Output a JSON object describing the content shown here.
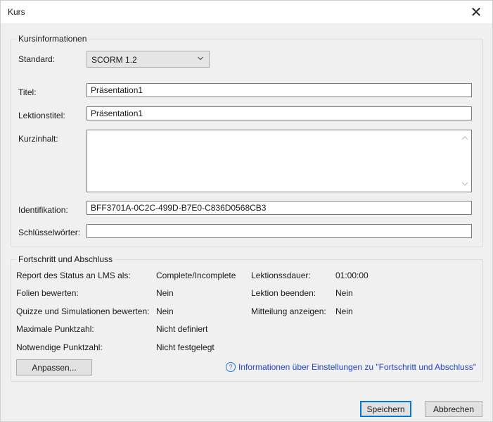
{
  "window": {
    "title": "Kurs",
    "close_glyph": "✕"
  },
  "course_info": {
    "legend": "Kursinformationen",
    "standard_label": "Standard:",
    "standard_value": "SCORM 1.2",
    "title_label": "Titel:",
    "title_value": "Präsentation1",
    "lesson_title_label": "Lektionstitel:",
    "lesson_title_value": "Präsentation1",
    "summary_label": "Kurzinhalt:",
    "summary_value": "",
    "id_label": "Identifikation:",
    "id_value": "BFF3701A-0C2C-499D-B7E0-C836D0568CB3",
    "keywords_label": "Schlüsselwörter:",
    "keywords_value": ""
  },
  "progress": {
    "legend": "Fortschritt und Abschluss",
    "rows_left": [
      {
        "label": "Report des Status an LMS als:",
        "value": "Complete/Incomplete"
      },
      {
        "label": "Folien bewerten:",
        "value": "Nein"
      },
      {
        "label": "Quizze und Simulationen bewerten:",
        "value": "Nein"
      },
      {
        "label": "Maximale Punktzahl:",
        "value": "Nicht definiert"
      },
      {
        "label": "Notwendige Punktzahl:",
        "value": "Nicht festgelegt"
      }
    ],
    "rows_right": [
      {
        "label": "Lektionssdauer:",
        "value": "01:00:00"
      },
      {
        "label": "Lektion beenden:",
        "value": "Nein"
      },
      {
        "label": "Mitteilung anzeigen:",
        "value": "Nein"
      }
    ],
    "customize_label": "Anpassen...",
    "info_icon_glyph": "?",
    "info_link_text": "Informationen über Einstellungen zu \"Fortschritt und Abschluss\""
  },
  "footer": {
    "save_label": "Speichern",
    "cancel_label": "Abbrechen"
  },
  "icons": {
    "close": "close-icon",
    "dropdown": "chevron-down-icon",
    "info": "info-circle-icon",
    "scroll_up": "scroll-up-arrow-icon",
    "scroll_down": "scroll-down-arrow-icon"
  },
  "colors": {
    "dialog_bg": "#f0f0f0",
    "link": "#2244cc",
    "primary_border": "#0078d7"
  }
}
